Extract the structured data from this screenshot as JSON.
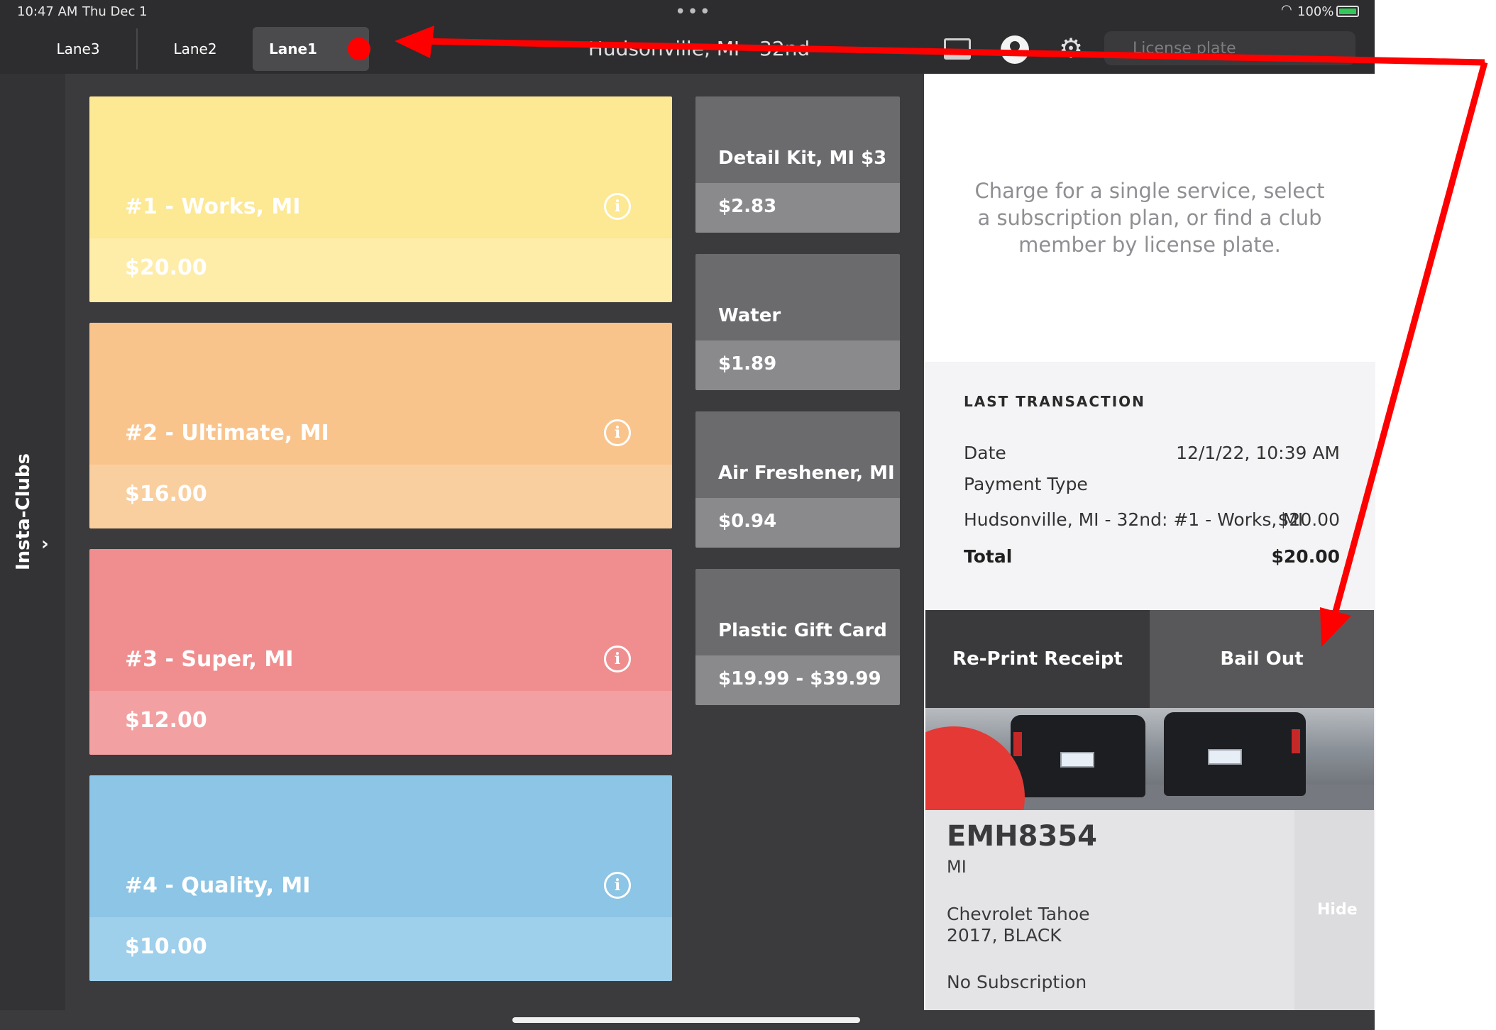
{
  "status_bar": {
    "time": "10:47 AM",
    "date": "Thu Dec 1",
    "battery": "100%"
  },
  "nav": {
    "lanes": [
      "Lane3",
      "Lane2",
      "Lane1"
    ],
    "active_lane": "Lane1",
    "location_title": "Hudsonville, MI - 32nd",
    "plate_search_placeholder": "License plate"
  },
  "sidebar": {
    "label": "Insta-Clubs",
    "chevron": "›"
  },
  "washes": [
    {
      "name": "#1 - Works, MI",
      "price": "$20.00",
      "color_top": "#fde893",
      "color_bottom": "#feeca9"
    },
    {
      "name": "#2 - Ultimate, MI",
      "price": "$16.00",
      "color_top": "#f9c48c",
      "color_bottom": "#f9cf9f"
    },
    {
      "name": "#3 - Super, MI",
      "price": "$12.00",
      "color_top": "#f08e8f",
      "color_bottom": "#f3a0a2"
    },
    {
      "name": "#4 - Quality, MI",
      "price": "$10.00",
      "color_top": "#8cc5e5",
      "color_bottom": "#9ecfeb"
    }
  ],
  "info_icon": "i",
  "addons": [
    {
      "name": "Detail Kit, MI  $3",
      "price": "$2.83"
    },
    {
      "name": "Water",
      "price": "$1.89"
    },
    {
      "name": "Air Freshener, MI",
      "price": "$0.94"
    },
    {
      "name": "Plastic Gift Card",
      "price": "$19.99 - $39.99"
    }
  ],
  "prompt": "Charge for a single service, select a subscription plan, or find a club member by license plate.",
  "last_transaction": {
    "heading": "LAST TRANSACTION",
    "date_label": "Date",
    "date_value": "12/1/22, 10:39 AM",
    "payment_type_label": "Payment Type",
    "item_label": "Hudsonville, MI - 32nd: #1 - Works, MI",
    "item_value": "$20.00",
    "total_label": "Total",
    "total_value": "$20.00"
  },
  "buttons": {
    "reprint": "Re-Print Receipt",
    "bail_out": "Bail Out"
  },
  "vehicle": {
    "plate": "EMH8354",
    "state": "MI",
    "model": "Chevrolet Tahoe",
    "year_color": "2017, BLACK",
    "subscription": "No Subscription",
    "hide": "Hide"
  },
  "colors": {
    "annotation_arrow": "#ff0000",
    "addon_top": "#6b6b6e",
    "addon_bottom": "#8a8a8d",
    "dark_bg": "#3b3b3d"
  }
}
